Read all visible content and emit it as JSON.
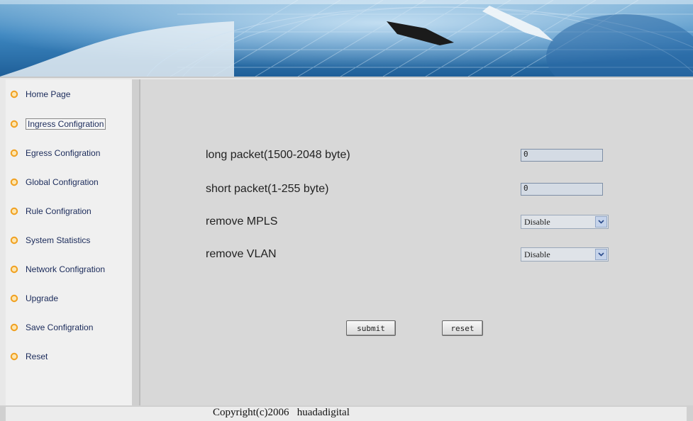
{
  "footer": {
    "copyright": "Copyright(c)2006   huadadigital"
  },
  "sidebar": {
    "items": [
      {
        "label": "Home Page"
      },
      {
        "label": "Ingress Configration"
      },
      {
        "label": "Egress Configration"
      },
      {
        "label": "Global Configration"
      },
      {
        "label": "Rule Configration"
      },
      {
        "label": "System Statistics"
      },
      {
        "label": "Network Configration"
      },
      {
        "label": "Upgrade"
      },
      {
        "label": "Save Configration"
      },
      {
        "label": "Reset"
      }
    ],
    "active_index": 1
  },
  "form": {
    "long_packet": {
      "label": "long packet(1500-2048 byte)",
      "value": "0"
    },
    "short_packet": {
      "label": "short packet(1-255 byte)",
      "value": "0"
    },
    "remove_mpls": {
      "label": "remove MPLS",
      "value": "Disable"
    },
    "remove_vlan": {
      "label": "remove VLAN",
      "value": "Disable"
    },
    "submit_label": "submit",
    "reset_label": "reset"
  },
  "colors": {
    "bullet": "#f0a020",
    "nav_text": "#1a2a5a",
    "banner": "#3c86c0"
  },
  "icons": {
    "bullet": "orange-ring-icon",
    "dropdown": "chevron-down-icon"
  }
}
